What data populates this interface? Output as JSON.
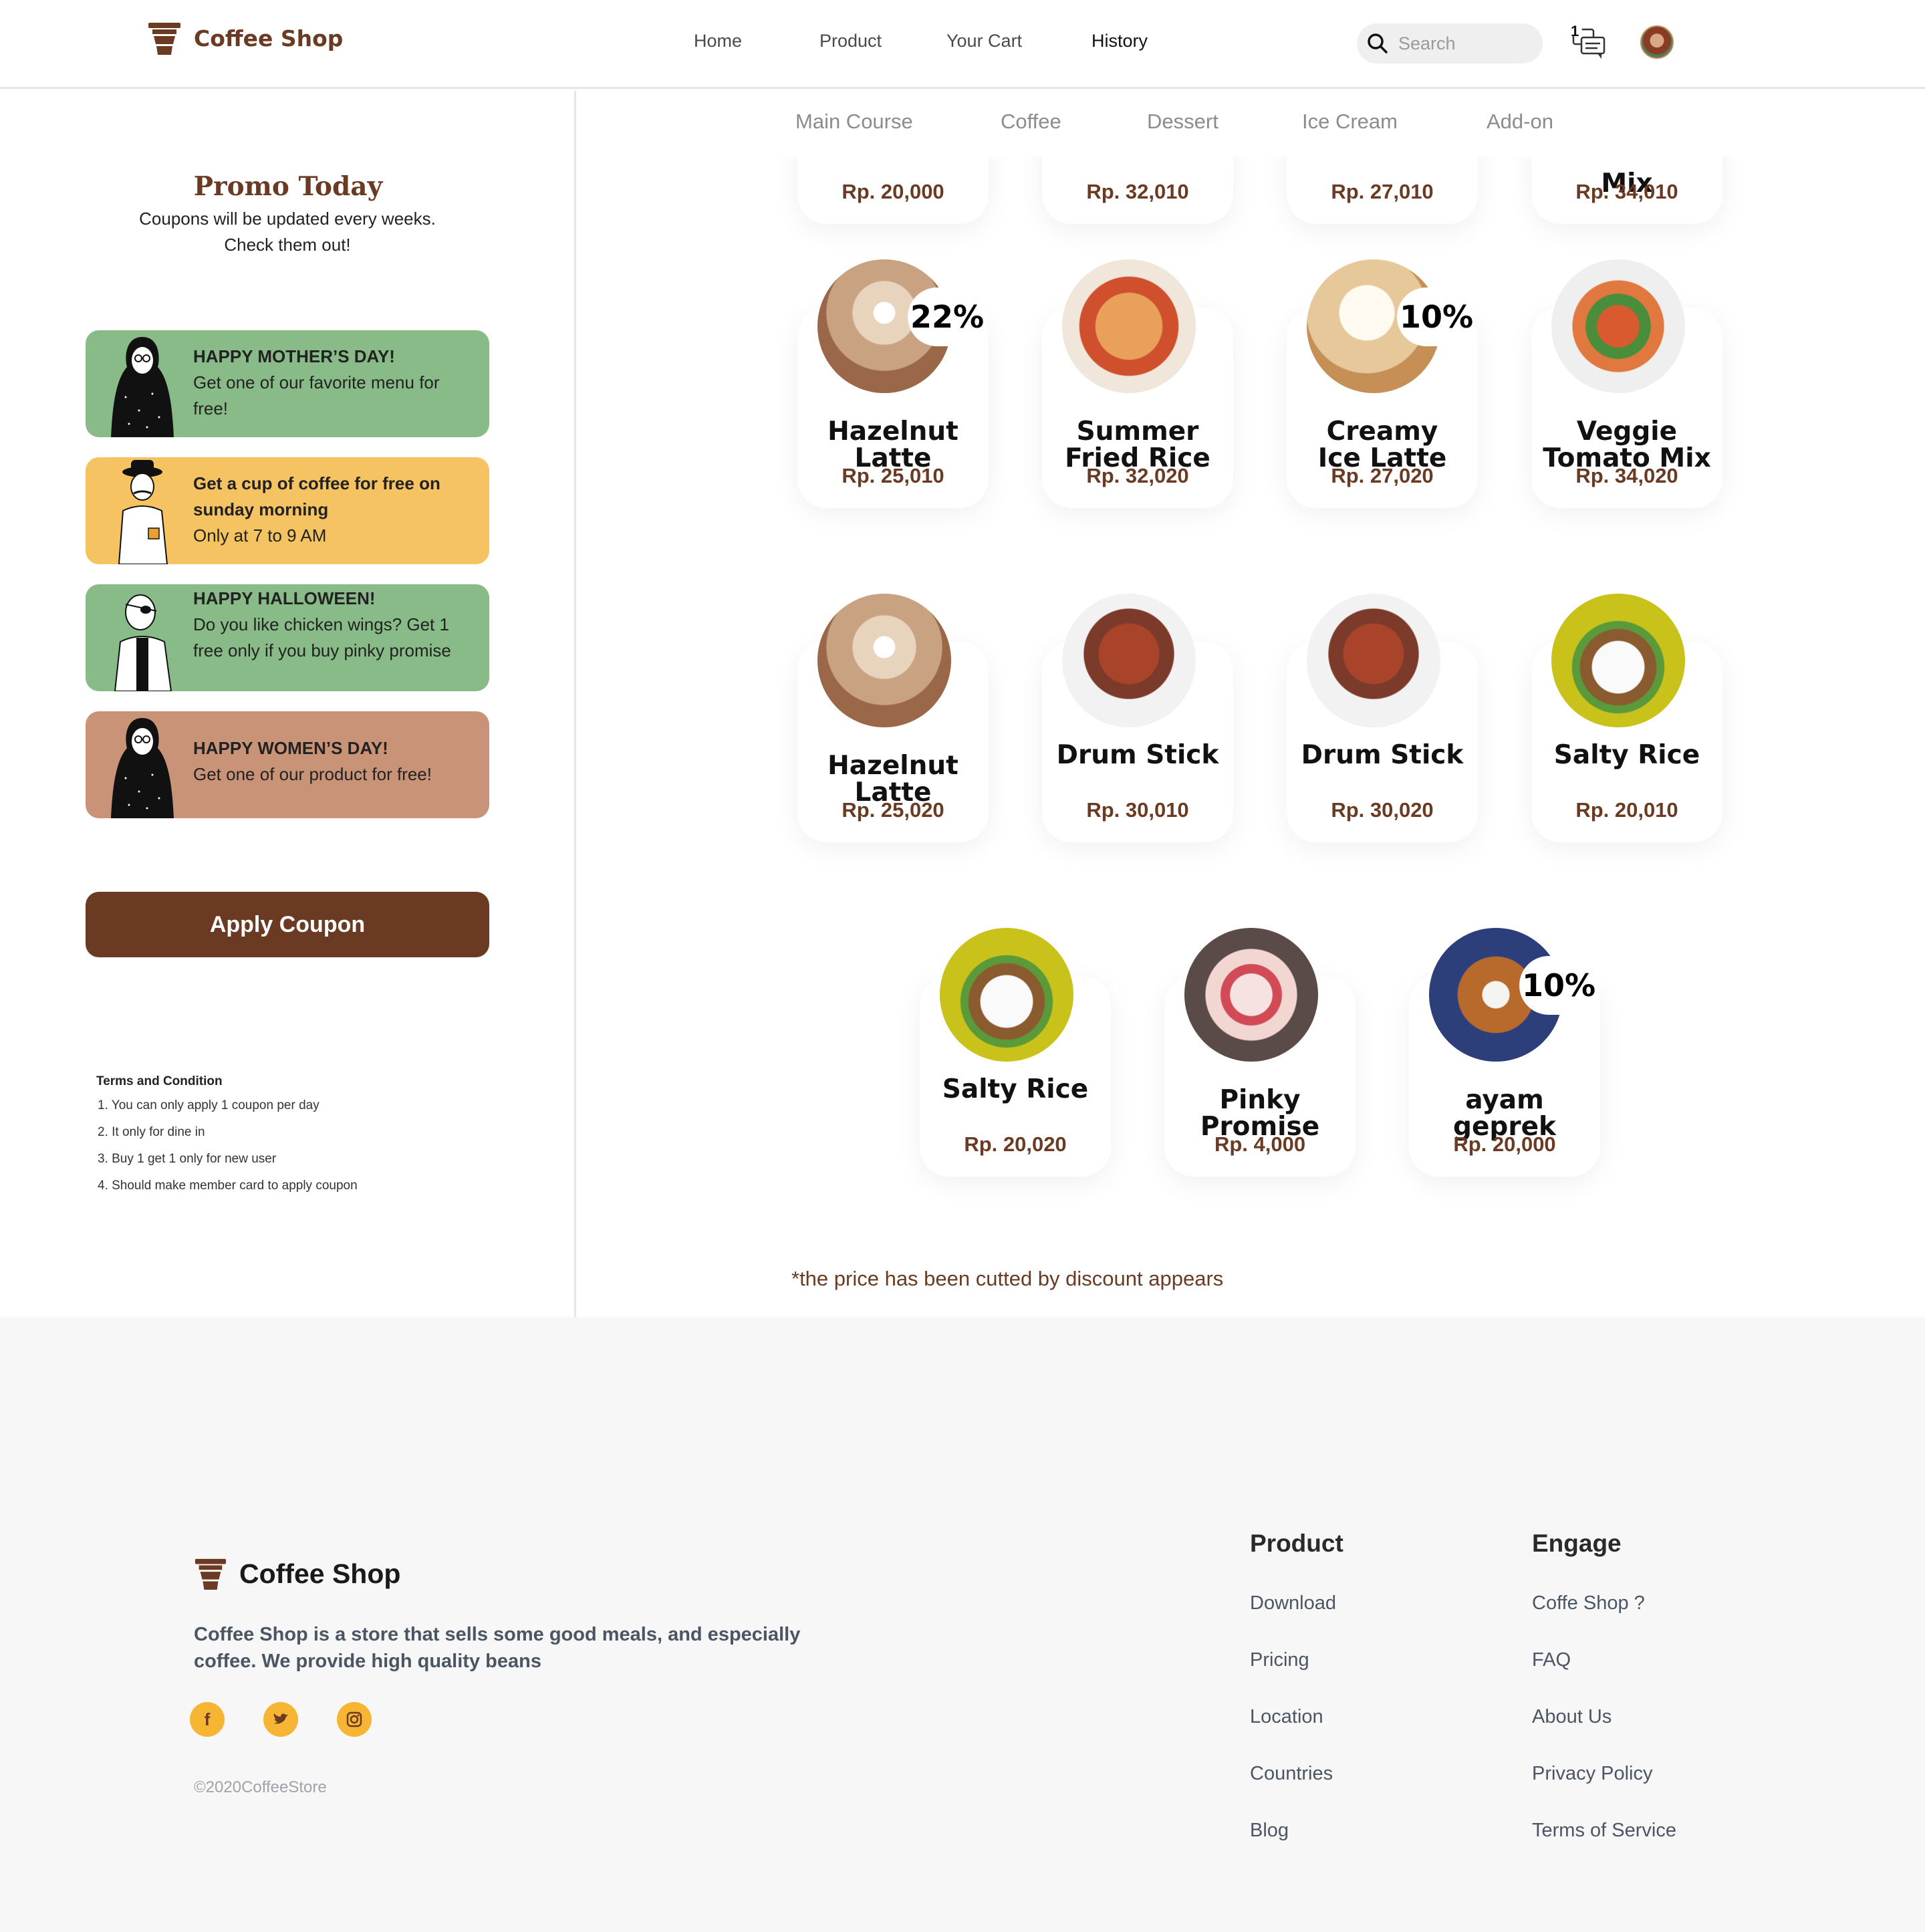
{
  "brand": {
    "name": "Coffee Shop",
    "color": "#6a3b22"
  },
  "nav": {
    "home": "Home",
    "product": "Product",
    "cart": "Your Cart",
    "history": "History"
  },
  "search": {
    "placeholder": "Search"
  },
  "chat": {
    "badge": "1"
  },
  "promo": {
    "title": "Promo Today",
    "subtitle_line1": "Coupons will be updated every weeks.",
    "subtitle_line2": "Check them out!",
    "coupons": [
      {
        "head": "HAPPY MOTHER’S DAY!",
        "body": "Get one of our favorite menu for free!",
        "color": "#88bb88"
      },
      {
        "head": "Get a cup of coffee for free on sunday morning",
        "body": "Only at 7 to 9 AM",
        "color": "#f5c361"
      },
      {
        "head": "HAPPY HALLOWEEN!",
        "body": "Do you like chicken wings? Get 1 free only if you buy pinky promise",
        "color": "#88bb88"
      },
      {
        "head": "HAPPY WOMEN’S DAY!",
        "body": "Get one of our product for free!",
        "color": "#c99378"
      }
    ],
    "apply_label": "Apply Coupon",
    "terms_title": "Terms and Condition",
    "terms": [
      "1. You can only apply 1 coupon per day",
      "2. It only for dine in",
      "3. Buy 1 get 1 only for new user",
      "4. Should make member card to apply coupon"
    ]
  },
  "categories": [
    "Main Course",
    "Coffee",
    "Dessert",
    "Ice Cream",
    "Add-on"
  ],
  "products_top_row": [
    {
      "name": "",
      "price": "Rp. 20,000"
    },
    {
      "name": "",
      "price": "Rp. 32,010"
    },
    {
      "name": "",
      "price": "Rp. 27,010"
    },
    {
      "name": "Mix",
      "price": "Rp. 34,010"
    }
  ],
  "products": [
    {
      "name_line1": "Hazelnut",
      "name_line2": "Latte",
      "price": "Rp. 25,010",
      "badge": "22%",
      "image": "latte"
    },
    {
      "name_line1": "Summer",
      "name_line2": "Fried Rice",
      "price": "Rp. 32,020",
      "badge": "",
      "image": "fried-rice"
    },
    {
      "name_line1": "Creamy",
      "name_line2": "Ice Latte",
      "price": "Rp. 27,020",
      "badge": "10%",
      "image": "ice-latte"
    },
    {
      "name_line1": "Veggie",
      "name_line2": "Tomato Mix",
      "price": "Rp. 34,020",
      "badge": "",
      "image": "veggie"
    },
    {
      "name_line1": "Hazelnut",
      "name_line2": "Latte",
      "price": "Rp. 25,020",
      "badge": "",
      "image": "latte"
    },
    {
      "name_line1": "Drum Stick",
      "name_line2": "",
      "price": "Rp. 30,010",
      "badge": "",
      "image": "drumstick"
    },
    {
      "name_line1": "Drum Stick",
      "name_line2": "",
      "price": "Rp. 30,020",
      "badge": "",
      "image": "drumstick"
    },
    {
      "name_line1": "Salty Rice",
      "name_line2": "",
      "price": "Rp. 20,010",
      "badge": "",
      "image": "salty-rice"
    },
    {
      "name_line1": "Salty Rice",
      "name_line2": "",
      "price": "Rp. 20,020",
      "badge": "",
      "image": "salty-rice"
    },
    {
      "name_line1": "Pinky",
      "name_line2": "Promise",
      "price": "Rp. 4,000",
      "badge": "",
      "image": "pinky"
    },
    {
      "name_line1": "ayam",
      "name_line2": "geprek",
      "price": "Rp. 20,000",
      "badge": "10%",
      "image": "geprek"
    }
  ],
  "note": "*the price has been cutted by discount appears",
  "footer": {
    "brand": "Coffee Shop",
    "description": "Coffee Shop is a store that sells some good meals, and especially coffee. We provide high quality beans",
    "copyright": "©2020CoffeeStore",
    "product_title": "Product",
    "product_links": [
      "Download",
      "Pricing",
      "Location",
      "Countries",
      "Blog"
    ],
    "engage_title": "Engage",
    "engage_links": [
      "Coffe Shop ?",
      "FAQ",
      "About Us",
      "Privacy Policy",
      "Terms of Service"
    ]
  }
}
